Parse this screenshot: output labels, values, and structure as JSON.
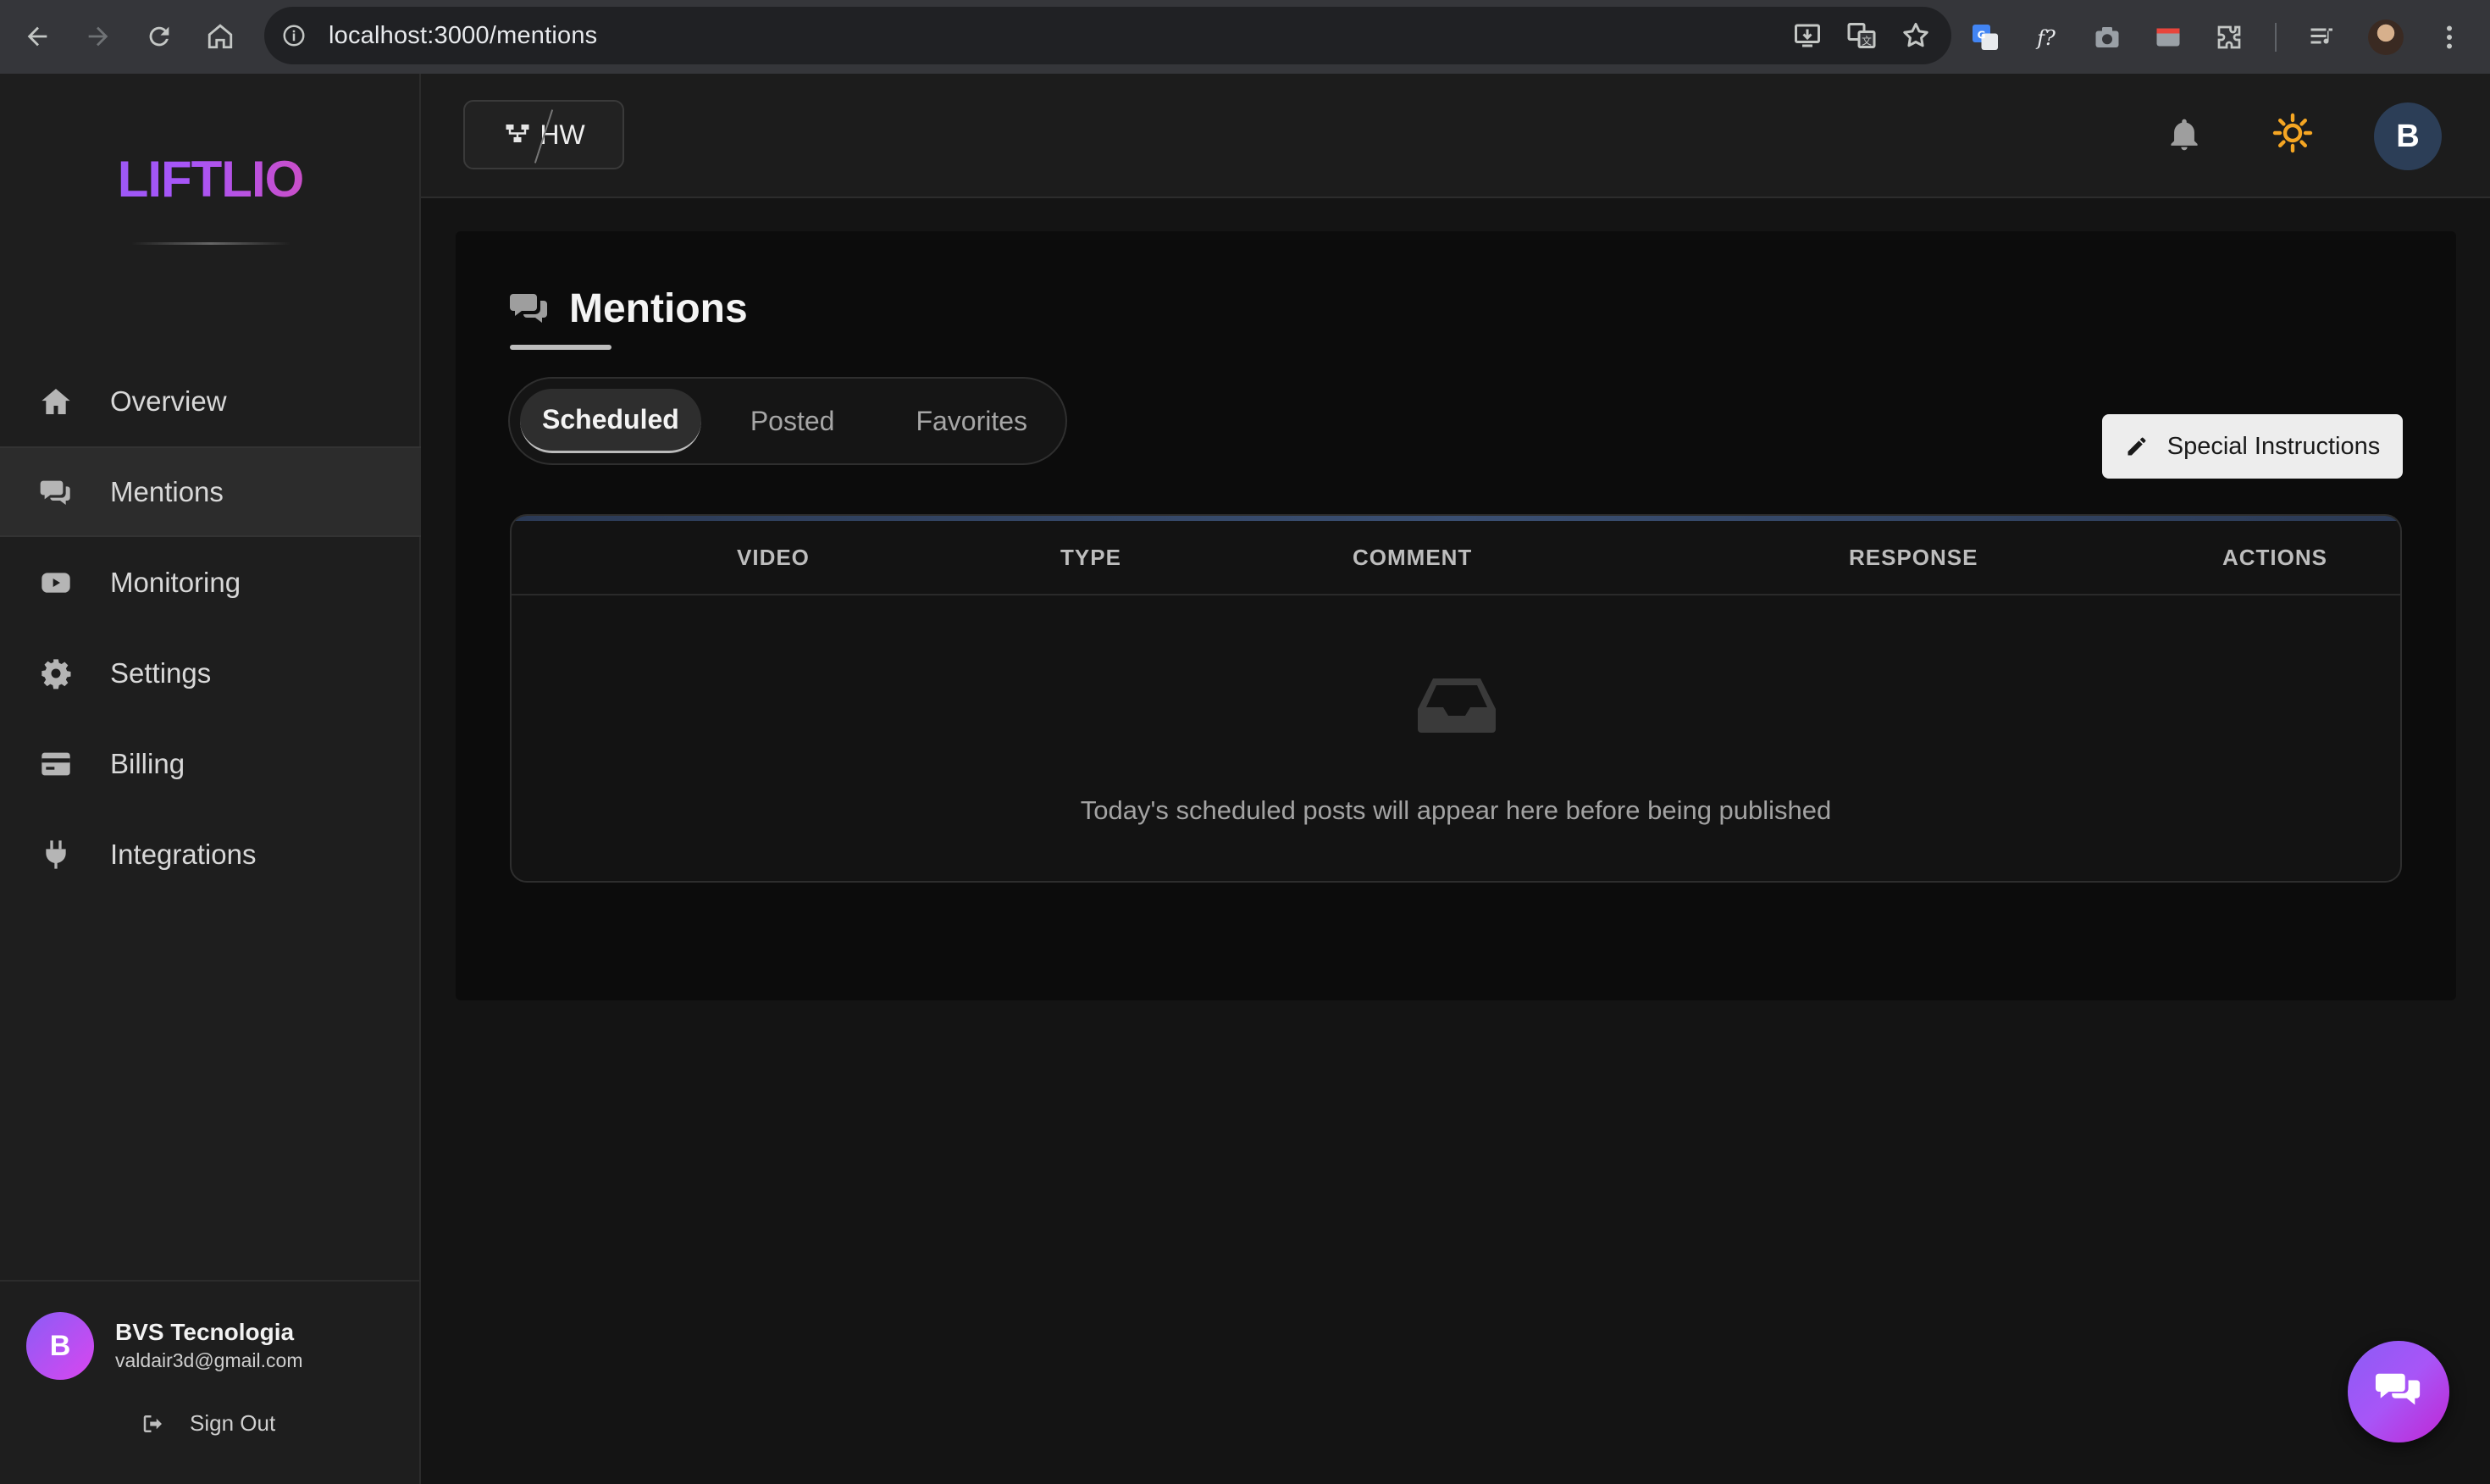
{
  "browser": {
    "url": "localhost:3000/mentions",
    "icons": {
      "back": "arrow-left-icon",
      "forward": "arrow-right-icon",
      "reload": "reload-icon",
      "home": "home-icon",
      "site_info": "info-icon",
      "install": "install-app-icon",
      "translate": "translate-icon",
      "bookmark": "star-icon"
    }
  },
  "sidebar": {
    "logo": "LIFTLIO",
    "items": [
      {
        "label": "Overview",
        "icon": "home-icon",
        "active": false
      },
      {
        "label": "Mentions",
        "icon": "comments-icon",
        "active": true
      },
      {
        "label": "Monitoring",
        "icon": "youtube-icon",
        "active": false
      },
      {
        "label": "Settings",
        "icon": "gear-icon",
        "active": false
      },
      {
        "label": "Billing",
        "icon": "credit-card-icon",
        "active": false
      },
      {
        "label": "Integrations",
        "icon": "plug-icon",
        "active": false
      }
    ],
    "user": {
      "initial": "B",
      "name": "BVS Tecnologia",
      "email": "valdair3d@gmail.com",
      "sign_out": "Sign Out"
    }
  },
  "header": {
    "project_label": "HW",
    "avatar_initial": "B",
    "colors": {
      "sun": "#f5a623",
      "avatar_bg": "#2c3e57"
    }
  },
  "main": {
    "title": "Mentions",
    "tabs": [
      {
        "label": "Scheduled",
        "active": true
      },
      {
        "label": "Posted",
        "active": false
      },
      {
        "label": "Favorites",
        "active": false
      }
    ],
    "special_instructions": "Special Instructions",
    "table": {
      "columns": [
        "VIDEO",
        "TYPE",
        "COMMENT",
        "RESPONSE",
        "ACTIONS"
      ],
      "rows": [],
      "empty_message": "Today's scheduled posts will appear here before being published"
    }
  },
  "colors": {
    "brand_gradient": [
      "#8b5cf6",
      "#ec4899"
    ],
    "background": "#141414",
    "panel": "#0c0c0c"
  }
}
